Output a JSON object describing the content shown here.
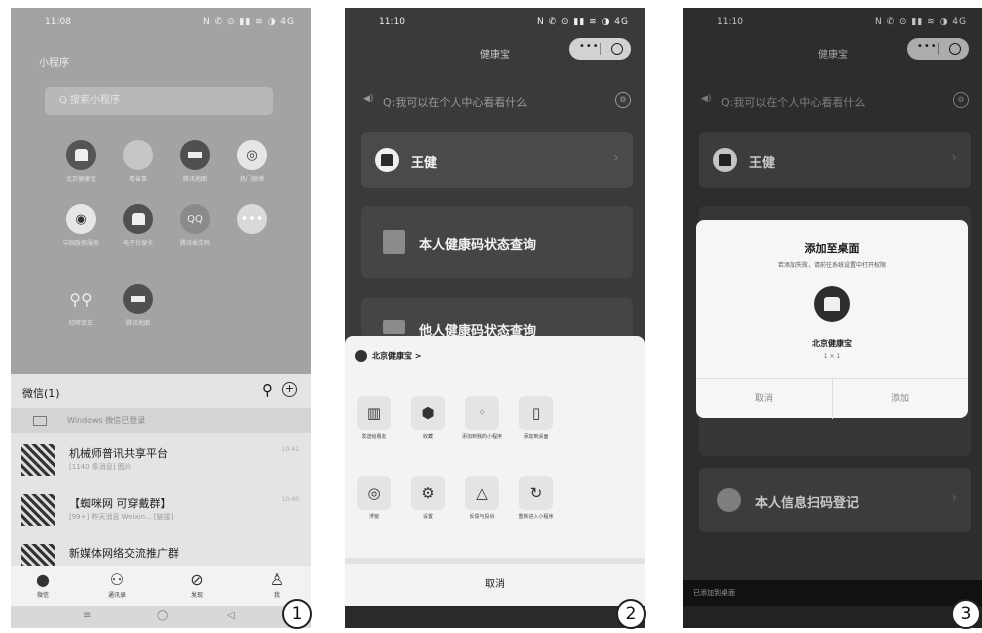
{
  "labels": [
    "1",
    "2",
    "3"
  ],
  "phone1": {
    "status_time": "11:08",
    "status_icons": "✉ ◼ ⚙ ▣",
    "status_right": "N ✆ ⊙ ▮▮ ≋ ◑ 4G",
    "mini_title": "小程序",
    "search_placeholder": "Q 搜索小程序",
    "apps": [
      {
        "label": "北京健康宝"
      },
      {
        "label": "粤省事"
      },
      {
        "label": "腾讯地图"
      },
      {
        "label": "热门微博"
      },
      {
        "label": "中国政务服务"
      },
      {
        "label": "电子社保卡"
      },
      {
        "label": "腾讯乘车码"
      },
      {
        "label": ""
      },
      {
        "label": "哈啰单车"
      },
      {
        "label": "腾讯地图"
      }
    ],
    "wechat_title": "微信(1)",
    "windows_login": "Windows 微信已登录",
    "chats": [
      {
        "name": "机械师普讯共享平台",
        "sub": "[1140 条消息] 图片",
        "time": "10:41"
      },
      {
        "name": "【蜘咪网 可穿戴群】",
        "sub": "[99+] 昨天消息 Weixin... [链接]",
        "time": "10:40"
      },
      {
        "name": "新媒体网络交流推广群",
        "sub": "",
        "time": ""
      }
    ],
    "tabs": [
      "微信",
      "通讯录",
      "发现",
      "我"
    ],
    "badge": "1"
  },
  "phone2": {
    "status_time": "11:10",
    "title": "健康宝",
    "hint": "Q:我可以在个人中心看看什么",
    "user_name": "王健",
    "card2": "本人健康码状态查询",
    "card3": "他人健康码状态查询",
    "sheet_title": "北京健康宝 >",
    "row1": [
      "发送给朋友",
      "收藏",
      "添加到我的小程序",
      "添加到桌面"
    ],
    "row2": [
      "浮窗",
      "设置",
      "反馈与投诉",
      "重新进入小程序"
    ],
    "cancel": "取消"
  },
  "phone3": {
    "status_time": "11:10",
    "title": "健康宝",
    "hint": "Q:我可以在个人中心看看什么",
    "user_name": "王健",
    "card_bottom": "本人信息扫码登记",
    "dialog_title": "添加至桌面",
    "dialog_sub": "若添加失败，请前往系统设置中打开权限",
    "app_name": "北京健康宝",
    "app_count": "1 × 1",
    "btn_cancel": "取消",
    "btn_add": "添加",
    "toast": "已添加到桌面"
  }
}
